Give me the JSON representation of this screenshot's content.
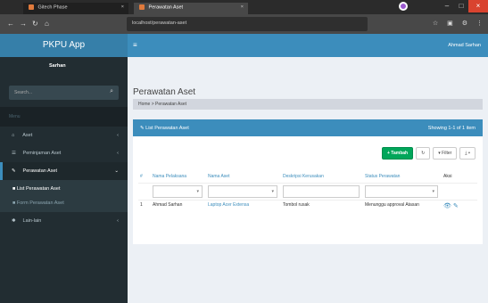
{
  "browser": {
    "tabs": [
      {
        "title": "Gitech Phase"
      },
      {
        "title": "Perawatan Aset"
      }
    ],
    "omnibox_text": "localhost/perawatan-aset"
  },
  "app": {
    "logo": "PKPU App",
    "user_name": "Sarhan",
    "search_placeholder": "Search...",
    "menu_header": "Menu",
    "menu": [
      {
        "label": "Aset"
      },
      {
        "label": "Peminjaman Aset"
      },
      {
        "label": "Perawatan Aset",
        "open": true
      },
      {
        "label": "Lain-lain"
      }
    ],
    "submenu": [
      {
        "label": "List Perawatan Aset",
        "active": true
      },
      {
        "label": "Form Perawatan Aset"
      }
    ],
    "top_user": "Ahmad Sarhan"
  },
  "page": {
    "title": "Perawatan Aset",
    "breadcrumb": "Home > Perawatan Aset"
  },
  "box": {
    "title": "List Perawatan Aset",
    "summary": "Showing 1-1 of 1 item",
    "buttons": {
      "create": "+ Tambah",
      "refresh": "↻",
      "filter": "▾ Filter",
      "export": "⤓ ▾"
    },
    "columns": [
      "#",
      "Nama Pelaksana",
      "Nama Aset",
      "Deskripsi Kerusakan",
      "Status Perawatan",
      "Aksi"
    ],
    "rows": [
      {
        "num": "1",
        "pelaksana": "Ahmad Sarhan",
        "aset": "Laptop Acer Extensa",
        "deskripsi": "Tombol rusak",
        "status": "Menunggu approval Atasan"
      }
    ]
  },
  "colors": {
    "primary": "#3c8dbc",
    "success": "#00a65a",
    "sidebar": "#222d32"
  }
}
